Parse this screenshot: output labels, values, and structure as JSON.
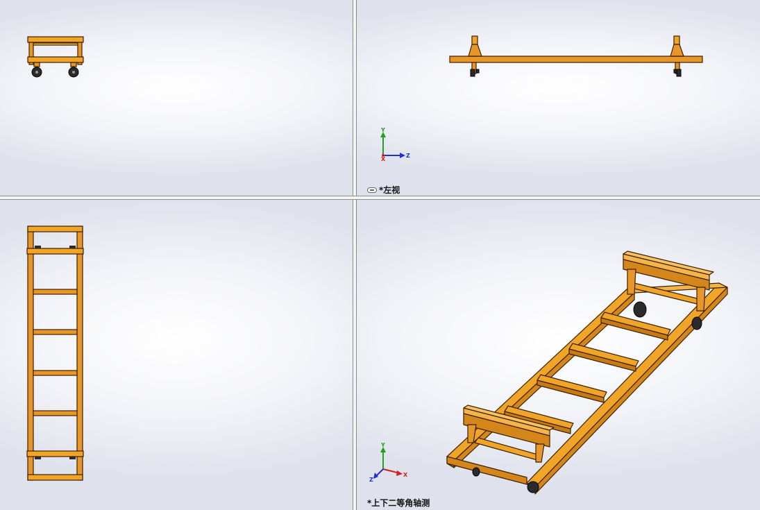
{
  "views": {
    "front": {
      "label": ""
    },
    "left": {
      "label": "*左视"
    },
    "top": {
      "label": ""
    },
    "iso": {
      "label": "*上下二等角轴测"
    }
  },
  "triad": {
    "x": "X",
    "y": "Y",
    "z": "Z"
  },
  "colors": {
    "frame": "#f0a428",
    "frame_dark": "#b06a08",
    "outline": "#3a2000",
    "wheel": "#2b2b2b",
    "axis_x": "#d02020",
    "axis_y": "#20a020",
    "axis_z": "#2030d0"
  },
  "icons": {
    "linked_view": "link-icon"
  }
}
